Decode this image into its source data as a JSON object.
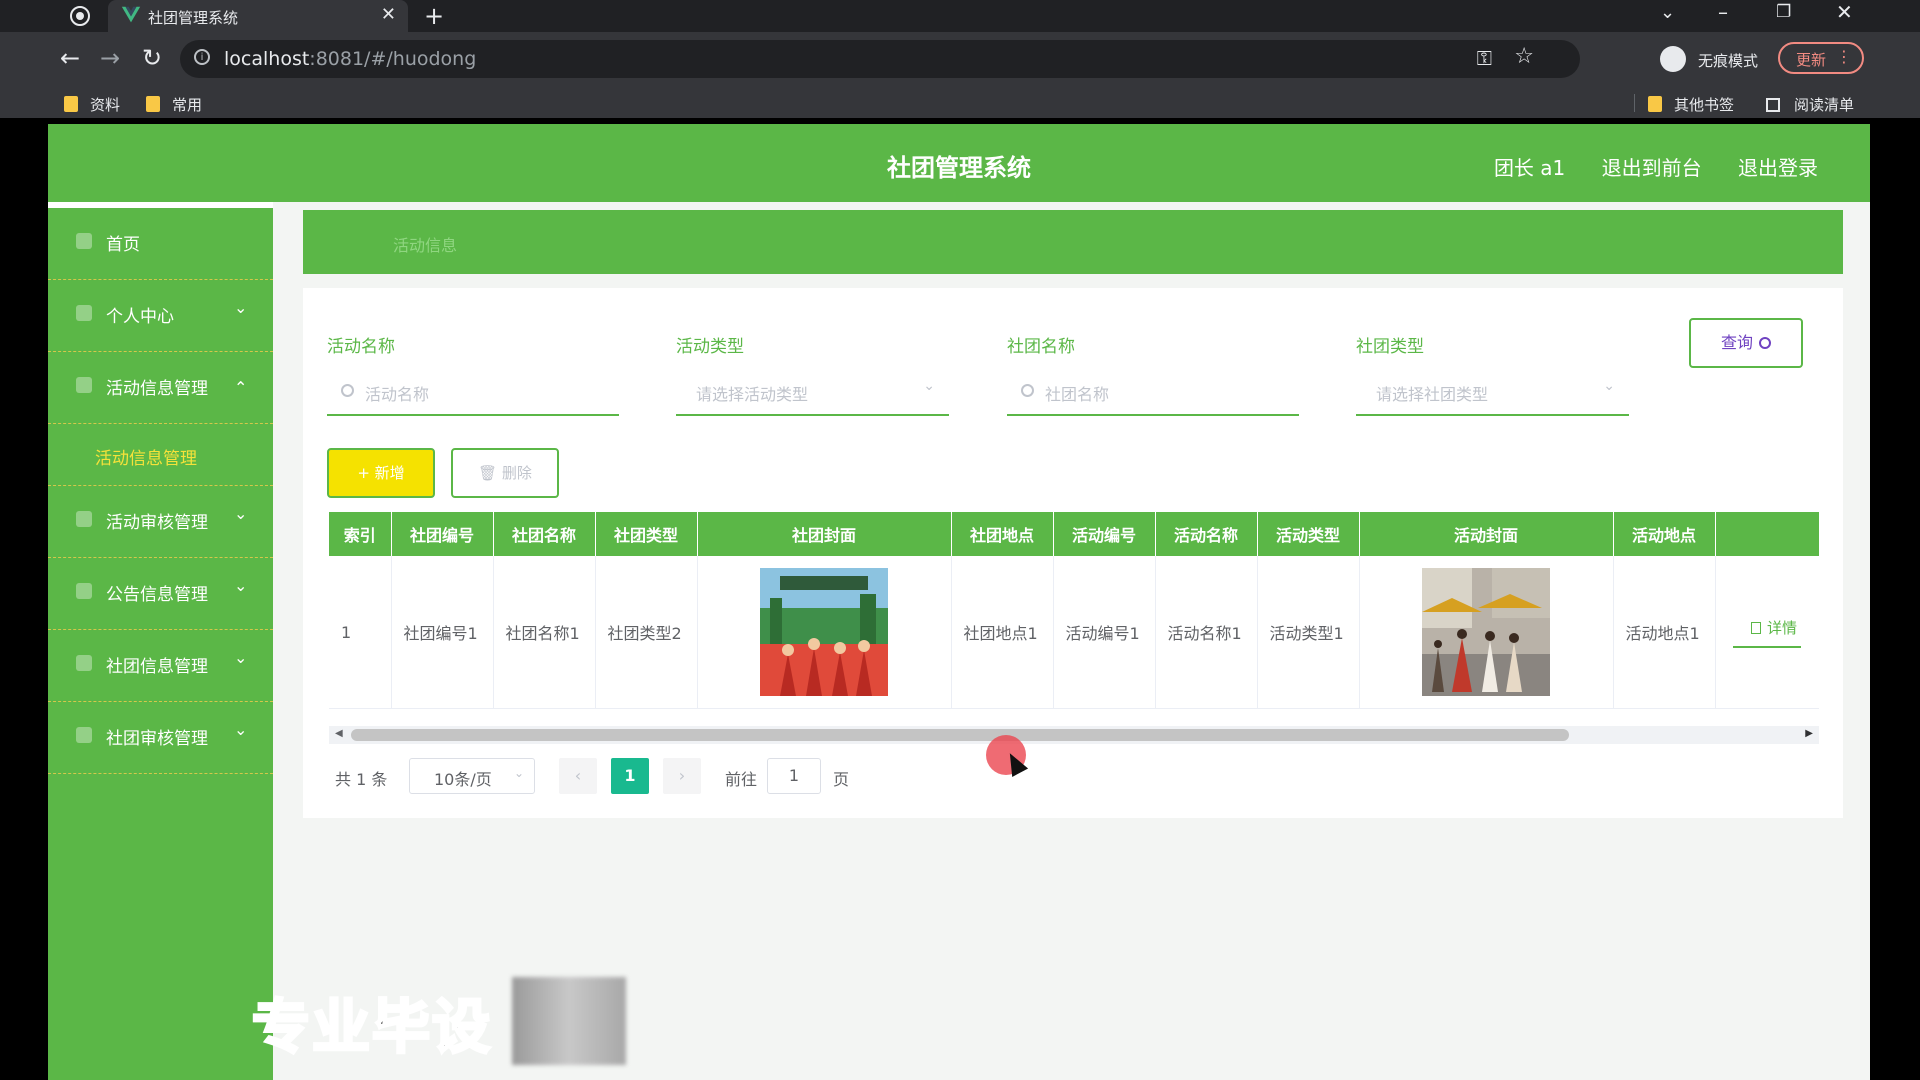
{
  "browser": {
    "tab_title": "社团管理系统",
    "url_host": "localhost",
    "url_rest": ":8081/#/huodong",
    "incognito_label": "无痕模式",
    "update_label": "更新",
    "bookmarks": [
      "资料",
      "常用"
    ],
    "other_bookmarks": "其他书签",
    "reading_list": "阅读清单"
  },
  "header": {
    "title": "社团管理系统",
    "user": "团长 a1",
    "to_front": "退出到前台",
    "logout": "退出登录"
  },
  "sidebar": {
    "items": [
      {
        "label": "首页",
        "icon": "home-icon"
      },
      {
        "label": "个人中心",
        "icon": "user-icon"
      },
      {
        "label": "活动信息管理",
        "icon": "menu-icon",
        "expanded": true
      },
      {
        "label": "活动审核管理",
        "icon": "menu-icon"
      },
      {
        "label": "公告信息管理",
        "icon": "menu-icon"
      },
      {
        "label": "社团信息管理",
        "icon": "user-icon"
      },
      {
        "label": "社团审核管理",
        "icon": "menu-icon"
      }
    ],
    "sub_item": "活动信息管理"
  },
  "breadcrumb": "活动信息",
  "filters": {
    "activity_name_label": "活动名称",
    "activity_name_placeholder": "活动名称",
    "activity_type_label": "活动类型",
    "activity_type_placeholder": "请选择活动类型",
    "club_name_label": "社团名称",
    "club_name_placeholder": "社团名称",
    "club_type_label": "社团类型",
    "club_type_placeholder": "请选择社团类型",
    "query_button": "查询"
  },
  "actions": {
    "add": "+ 新增",
    "delete": "删除"
  },
  "table": {
    "headers": [
      "索引",
      "社团编号",
      "社团名称",
      "社团类型",
      "社团封面",
      "社团地点",
      "活动编号",
      "活动名称",
      "活动类型",
      "活动封面",
      "活动地点",
      ""
    ],
    "row": {
      "index": "1",
      "club_no": "社团编号1",
      "club_name": "社团名称1",
      "club_type": "社团类型2",
      "club_location": "社团地点1",
      "activity_no": "活动编号1",
      "activity_name": "活动名称1",
      "activity_type": "活动类型1",
      "activity_location": "活动地点1",
      "detail": "详情"
    }
  },
  "pagination": {
    "total": "共 1 条",
    "page_size": "10条/页",
    "current": "1",
    "goto_label": "前往",
    "goto_value": "1",
    "goto_unit": "页"
  },
  "watermark": "专业毕设",
  "colors": {
    "brand_green": "#5bb747",
    "accent_yellow": "#f5e200",
    "page_active": "#19b98f"
  }
}
